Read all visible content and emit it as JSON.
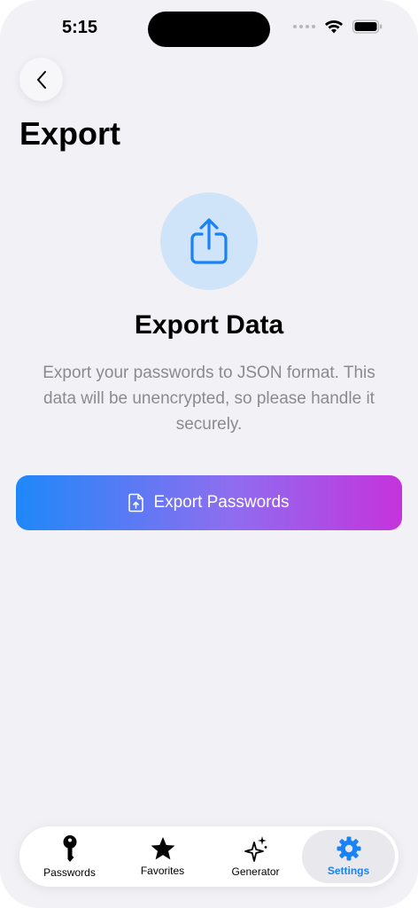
{
  "status_bar": {
    "time": "5:15"
  },
  "header": {
    "title": "Export"
  },
  "hero": {
    "title": "Export Data",
    "description": "Export your passwords to JSON format. This data will be unencrypted, so please handle it securely."
  },
  "actions": {
    "export_label": "Export Passwords"
  },
  "tabbar": {
    "items": [
      {
        "label": "Passwords",
        "icon": "key-icon"
      },
      {
        "label": "Favorites",
        "icon": "star-icon"
      },
      {
        "label": "Generator",
        "icon": "sparkles-icon"
      },
      {
        "label": "Settings",
        "icon": "gear-icon",
        "active": true
      }
    ]
  },
  "colors": {
    "accent": "#1a82f7",
    "gradient_start": "#1e88f9",
    "gradient_end": "#c533dc",
    "background": "#f2f1f6"
  }
}
